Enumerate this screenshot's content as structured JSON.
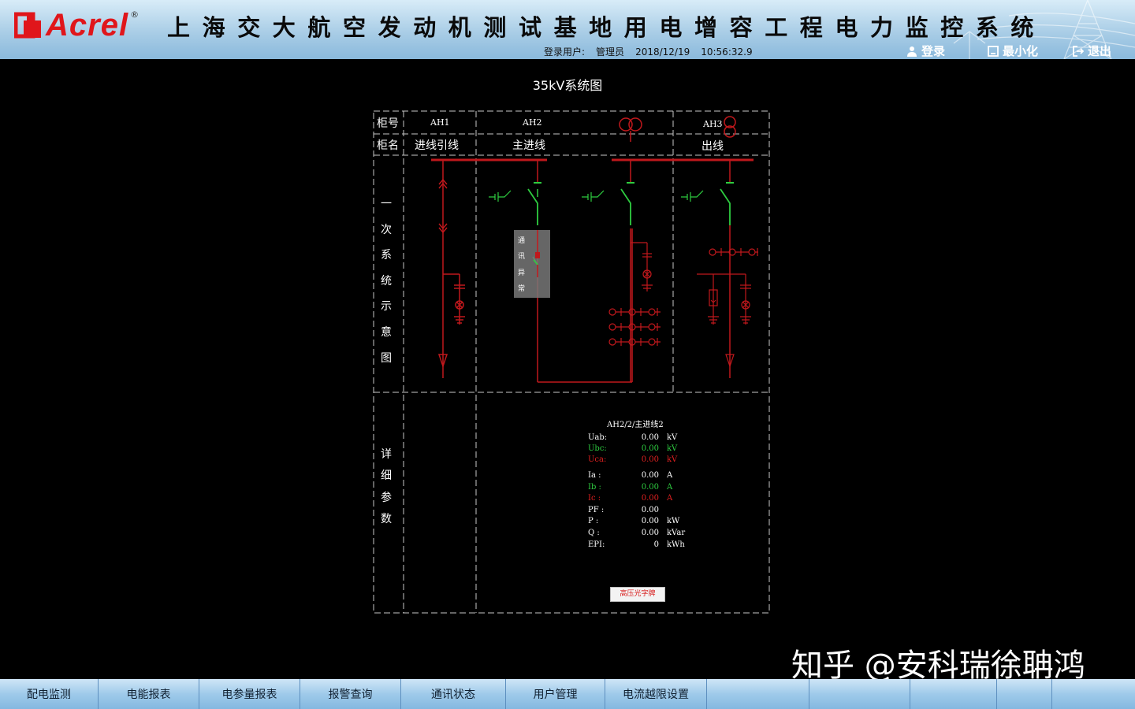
{
  "header": {
    "brand": "Acrel",
    "title": "上海交大航空发动机测试基地用电增容工程电力监控系统",
    "user_label": "登录用户:",
    "user_name": "管理员",
    "date": "2018/12/19",
    "time": "10:56:32.9",
    "login_label": "登录",
    "minimize_label": "最小化",
    "exit_label": "退出"
  },
  "page_title": "35kV系统图",
  "diagram": {
    "row_labels": {
      "cabinet_no": "柜号",
      "cabinet_name": "柜名"
    },
    "cabinets": [
      {
        "no": "AH1",
        "name": "进线引线"
      },
      {
        "no": "AH2",
        "name": "主进线"
      },
      {
        "no": "AH3",
        "name": "出线"
      }
    ],
    "section_primary": [
      "一",
      "次",
      "系",
      "统",
      "示",
      "意",
      "图"
    ],
    "section_details": [
      "详",
      "细",
      "参",
      "数"
    ],
    "comm_status": [
      "通",
      "讯",
      "异",
      "常"
    ]
  },
  "params": {
    "heading": "AH2/2/主进线2",
    "rows": [
      {
        "name": "Uab:",
        "value": "0.00",
        "unit": "kV",
        "color": "#ffffff"
      },
      {
        "name": "Ubc:",
        "value": "0.00",
        "unit": "kV",
        "color": "#2ecc40"
      },
      {
        "name": "Uca:",
        "value": "0.00",
        "unit": "kV",
        "color": "#e02020"
      },
      {
        "name": "Ia :",
        "value": "0.00",
        "unit": "A",
        "color": "#ffffff"
      },
      {
        "name": "Ib :",
        "value": "0.00",
        "unit": "A",
        "color": "#2ecc40"
      },
      {
        "name": "Ic :",
        "value": "0.00",
        "unit": "A",
        "color": "#e02020"
      },
      {
        "name": "PF :",
        "value": "0.00",
        "unit": "",
        "color": "#ffffff"
      },
      {
        "name": "P  :",
        "value": "0.00",
        "unit": "kW",
        "color": "#ffffff"
      },
      {
        "name": "Q  :",
        "value": "0.00",
        "unit": "kVar",
        "color": "#ffffff"
      },
      {
        "name": "EPI:",
        "value": "0",
        "unit": "kWh",
        "color": "#ffffff"
      }
    ],
    "button_label": "高压光字牌"
  },
  "watermark": "知乎 @安科瑞徐聃鸿",
  "nav": {
    "items": [
      "配电监测",
      "电能报表",
      "电参量报表",
      "报警查询",
      "通讯状态",
      "用户管理",
      "电流越限设置",
      "",
      "",
      "",
      ""
    ]
  },
  "colors": {
    "live": "#c0181c",
    "off": "#2ecc40",
    "grid": "#c8c8c8"
  }
}
